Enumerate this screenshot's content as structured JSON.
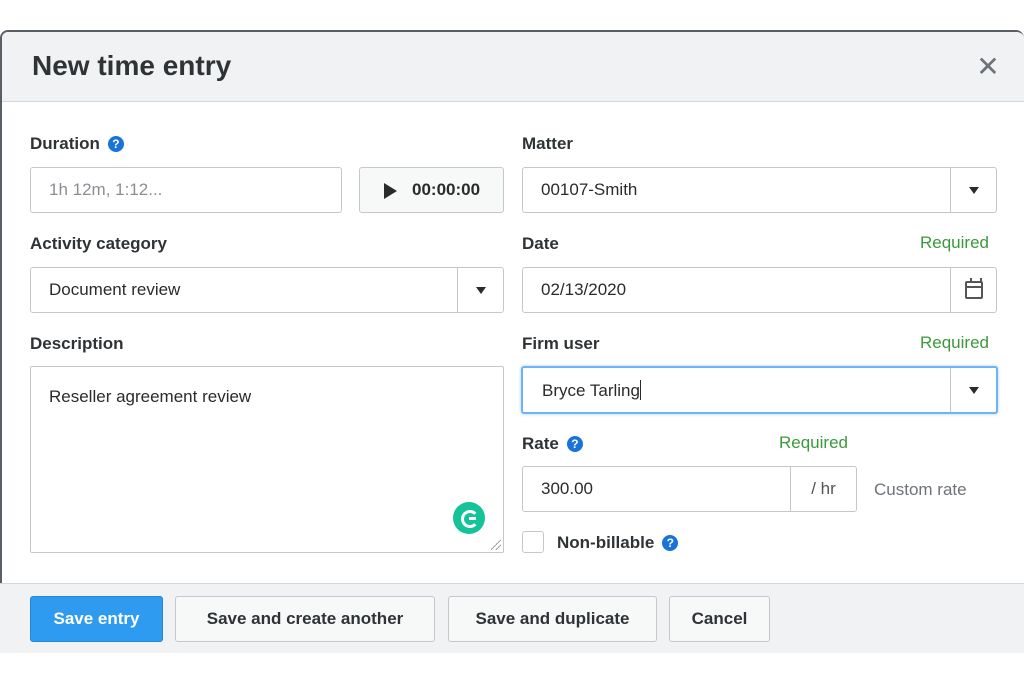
{
  "modal": {
    "title": "New time entry",
    "close_icon": "close-icon"
  },
  "duration": {
    "label": "Duration",
    "placeholder": "1h 12m, 1:12...",
    "help_icon": "help-icon"
  },
  "timer": {
    "value": "00:00:00",
    "icon": "play-icon"
  },
  "matter": {
    "label": "Matter",
    "value": "00107-Smith"
  },
  "activity_category": {
    "label": "Activity category",
    "value": "Document review"
  },
  "date": {
    "label": "Date",
    "required": "Required",
    "value": "02/13/2020",
    "icon": "calendar-icon"
  },
  "description": {
    "label": "Description",
    "value": "Reseller agreement review"
  },
  "firm_user": {
    "label": "Firm user",
    "required": "Required",
    "value": "Bryce Tarling"
  },
  "rate": {
    "label": "Rate",
    "required": "Required",
    "value": "300.00",
    "unit": "/ hr",
    "custom_rate": "Custom rate"
  },
  "non_billable": {
    "label": "Non-billable",
    "checked": false
  },
  "footer": {
    "save_entry": "Save entry",
    "save_and_create_another": "Save and create another",
    "save_and_duplicate": "Save and duplicate",
    "cancel": "Cancel"
  },
  "colors": {
    "primary": "#2f9bf0",
    "required_green": "#3a9a3a",
    "help_blue": "#1a73d9",
    "focus_blue": "#6eb3f5"
  }
}
